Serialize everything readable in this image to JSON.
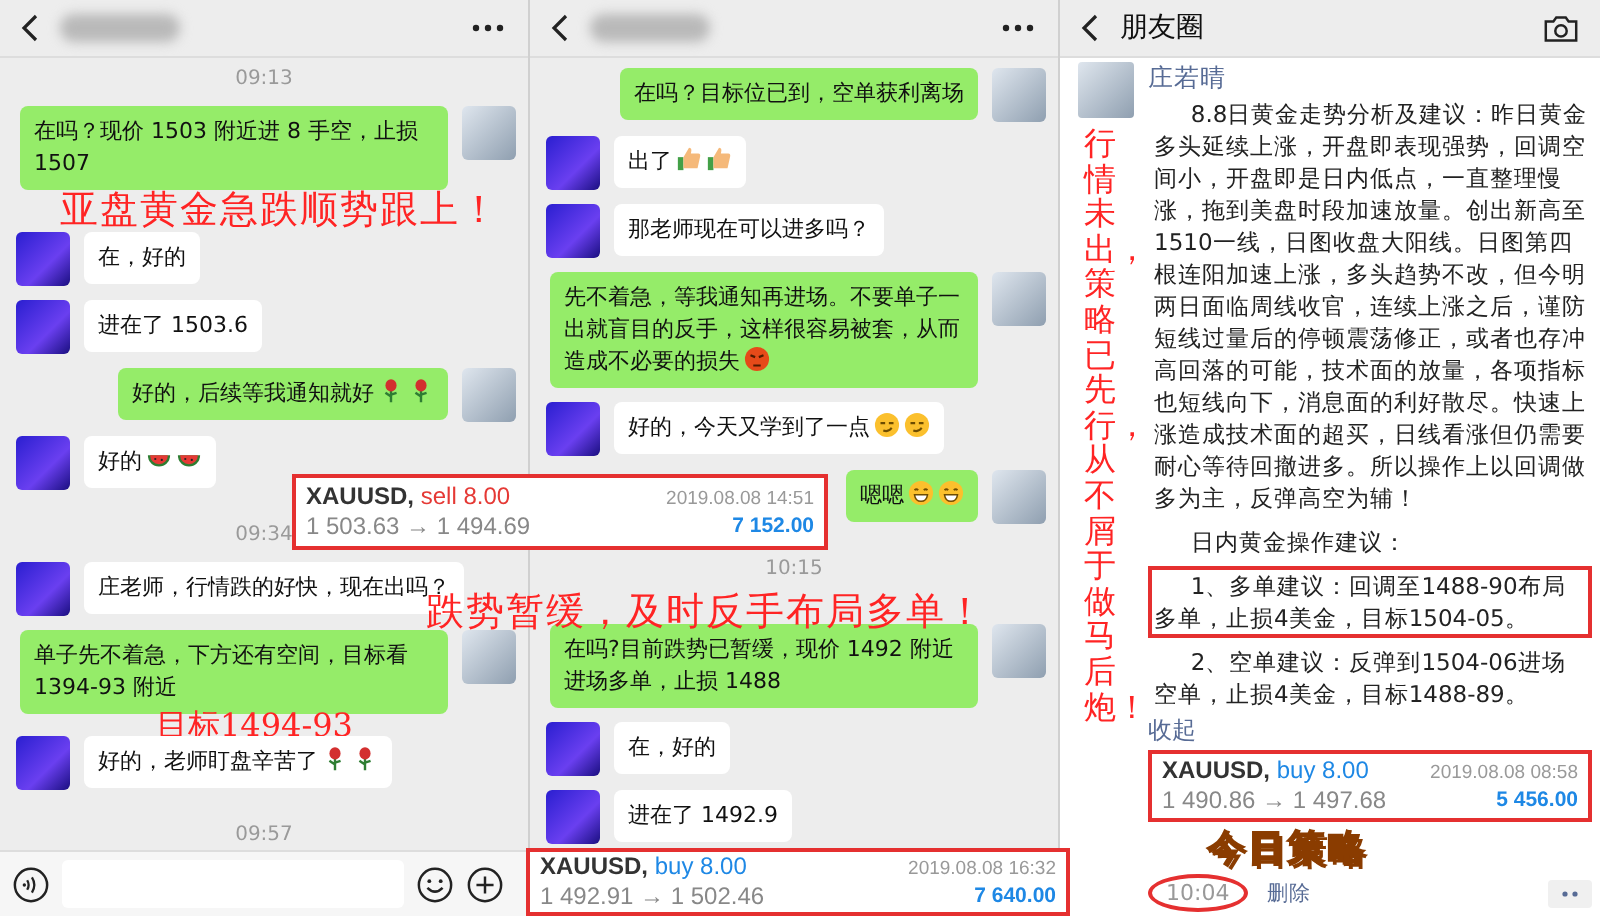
{
  "chats": [
    {
      "messages": [
        {
          "kind": "time",
          "text": "09:13"
        },
        {
          "kind": "message",
          "outgoing": true,
          "text": "在吗？现价 1503 附近进 8 手空，止损 1507"
        },
        {
          "kind": "annotation",
          "text": "亚盘黄金急跌顺势跟上！"
        },
        {
          "kind": "message",
          "outgoing": false,
          "text": "在，好的"
        },
        {
          "kind": "message",
          "outgoing": false,
          "text": "进在了 1503.6"
        },
        {
          "kind": "message",
          "outgoing": true,
          "text": "好的，后续等我通知就好",
          "emoji": [
            {
              "kind": "rose"
            },
            {
              "kind": "rose"
            }
          ]
        },
        {
          "kind": "message",
          "outgoing": false,
          "text": "好的",
          "emoji": [
            {
              "kind": "watermelon"
            },
            {
              "kind": "watermelon"
            }
          ]
        },
        {
          "kind": "time",
          "text": "09:34"
        },
        {
          "kind": "message",
          "outgoing": false,
          "text": "庄老师，行情跌的好快，现在出吗？"
        },
        {
          "kind": "message",
          "outgoing": true,
          "text": "单子先不着急，下方还有空间，目标看 1394-93 附近"
        },
        {
          "kind": "annotation",
          "text": "目标1494-93"
        },
        {
          "kind": "message",
          "outgoing": false,
          "text": "好的，老师盯盘辛苦了",
          "emoji": [
            {
              "kind": "rose"
            },
            {
              "kind": "rose"
            }
          ]
        },
        {
          "kind": "time",
          "text": "09:57"
        }
      ]
    },
    {
      "messages": [
        {
          "kind": "message",
          "outgoing": true,
          "text": "在吗？目标位已到，空单获利离场"
        },
        {
          "kind": "message",
          "outgoing": false,
          "text": "出了",
          "emoji": [
            {
              "kind": "thumbs_up"
            },
            {
              "kind": "thumbs_up"
            }
          ]
        },
        {
          "kind": "message",
          "outgoing": false,
          "text": "那老师现在可以进多吗？"
        },
        {
          "kind": "message",
          "outgoing": true,
          "text": "先不着急，等我通知再进场。不要单子一出就盲目的反手，这样很容易被套，从而造成不必要的损失",
          "emoji": [
            {
              "kind": "angry"
            }
          ]
        },
        {
          "kind": "message",
          "outgoing": false,
          "text": "好的，今天又学到了一点",
          "emoji": [
            {
              "kind": "smirk"
            },
            {
              "kind": "smirk"
            }
          ]
        },
        {
          "kind": "message",
          "outgoing": true,
          "text": "嗯嗯",
          "emoji": [
            {
              "kind": "grin"
            },
            {
              "kind": "grin"
            }
          ]
        },
        {
          "kind": "time",
          "text": "10:15"
        },
        {
          "kind": "annotation",
          "text": "跌势暂缓，及时反手布局多单！"
        },
        {
          "kind": "message",
          "outgoing": true,
          "text": "在吗?目前跌势已暂缓，现价 1492 附近进场多单，止损 1488"
        },
        {
          "kind": "message",
          "outgoing": false,
          "text": "在，好的"
        },
        {
          "kind": "message",
          "outgoing": false,
          "text": "进在了 1492.9"
        }
      ]
    }
  ],
  "trade_cards": [
    {
      "kind": "sell",
      "symbol": "XAUUSD,",
      "order": "sell 8.00",
      "prices": "1 503.63 → 1 494.69",
      "time": "2019.08.08 14:51",
      "profit": "7 152.00"
    },
    {
      "kind": "buy",
      "symbol": "XAUUSD,",
      "order": "buy 8.00",
      "prices": "1 492.91 → 1 502.46",
      "time": "2019.08.08 16:32",
      "profit": "7 640.00"
    }
  ],
  "moments": {
    "title": "朋友圈",
    "side_note": "行情未出，策略已先行，从不屑于做马后炮！",
    "post": {
      "author": "庄若晴",
      "paragraphs": [
        {
          "text": "8.8日黄金走势分析及建议：昨日黄金多头延续上涨，开盘即表现强势，回调空间小，开盘即是日内低点，一直整理慢涨，拖到美盘时段加速放量。创出新高至1510一线，日图收盘大阳线。日图第四根连阳加速上涨，多头趋势不改，但今明两日面临周线收官，连续上涨之后，谨防短线过量后的停顿震荡修正，或者也存冲高回落的可能，技术面的放量，各项指标也短线向下，消息面的利好散尽。快速上涨造成技术面的超买，日线看涨但仍需要耐心等待回撤进多。所以操作上以回调做多为主，反弹高空为辅！",
          "highlighted": false
        },
        {
          "text": "日内黄金操作建议：",
          "highlighted": false
        },
        {
          "text": "1、多单建议：回调至1488-90布局多单，止损4美金，目标1504-05。",
          "highlighted": true
        },
        {
          "text": "2、空单建议：反弹到1504-06进场空单，止损4美金，目标1488-89。",
          "highlighted": false
        }
      ],
      "collapse_link": "收起",
      "trade_card": {
        "kind": "buy",
        "symbol": "XAUUSD,",
        "order": "buy 8.00",
        "prices": "1 490.86 → 1 497.68",
        "time": "2019.08.08 08:58",
        "profit": "5 456.00"
      },
      "image_caption": "今日策略",
      "time": "10:04",
      "time_circled": true,
      "delete_link": "删除"
    }
  }
}
